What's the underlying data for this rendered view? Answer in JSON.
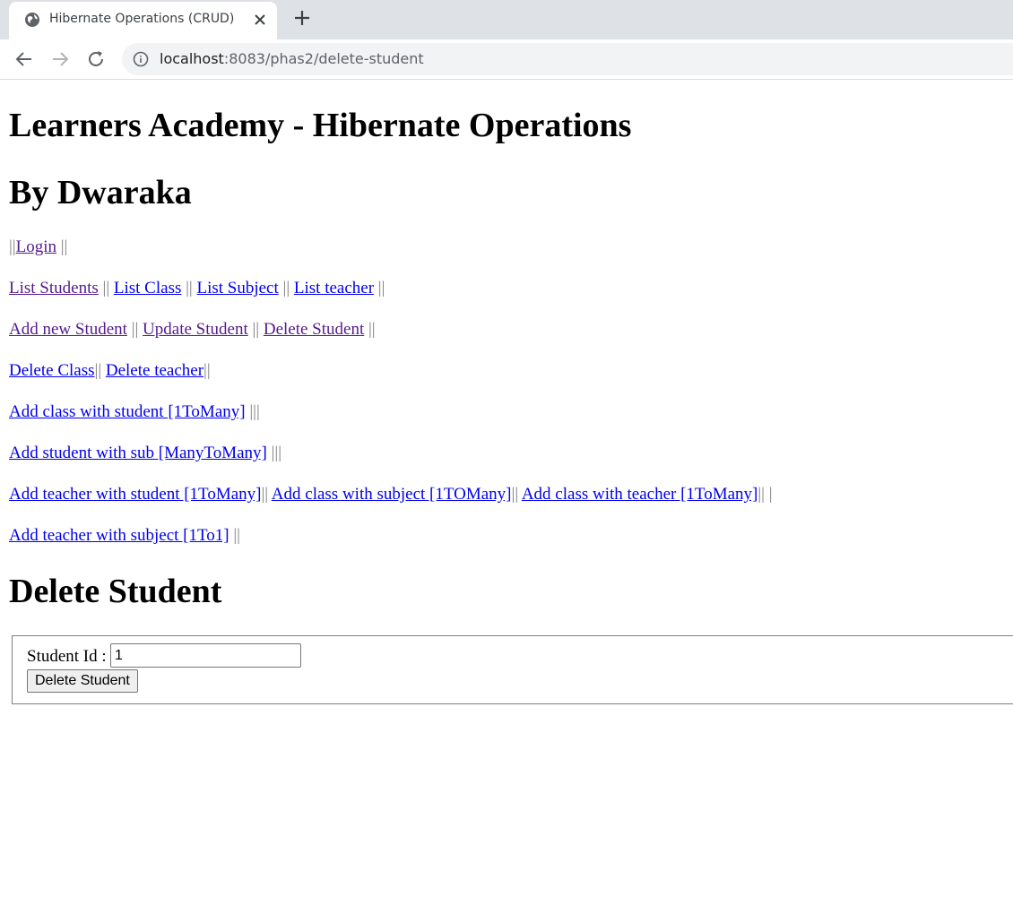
{
  "browser": {
    "tab_title": "Hibernate Operations (CRUD)",
    "url_host": "localhost",
    "url_rest": ":8083/phas2/delete-student"
  },
  "page": {
    "heading1": "Learners Academy - Hibernate Operations",
    "heading2": "By Dwaraka",
    "nav": {
      "login": "Login",
      "list_students": "List Students",
      "list_class": "List Class",
      "list_subject": "List Subject",
      "list_teacher": "List teacher",
      "add_new_student": "Add new Student",
      "update_student": "Update Student",
      "delete_student": "Delete Student",
      "delete_class": "Delete Class",
      "delete_teacher": "Delete teacher",
      "add_class_with_student": "Add class with student [1ToMany]",
      "add_student_with_sub": "Add student with sub [ManyToMany]",
      "add_teacher_with_student": "Add teacher with student [1ToMany]",
      "add_class_with_subject": "Add class with subject [1TOMany]",
      "add_class_with_teacher": "Add class with teacher [1ToMany]",
      "add_teacher_with_subject": "Add teacher with subject [1To1]"
    },
    "separators": {
      "double": "||",
      "double_spaced_before": " ||",
      "double_spaced_both": " || ",
      "double_trailing": "|| ",
      "triple_spaced": " |||",
      "double_space_single": "|| |"
    },
    "section_title": "Delete Student",
    "form": {
      "student_id_label": "Student Id :",
      "student_id_value": "1",
      "submit_label": "Delete Student"
    }
  }
}
